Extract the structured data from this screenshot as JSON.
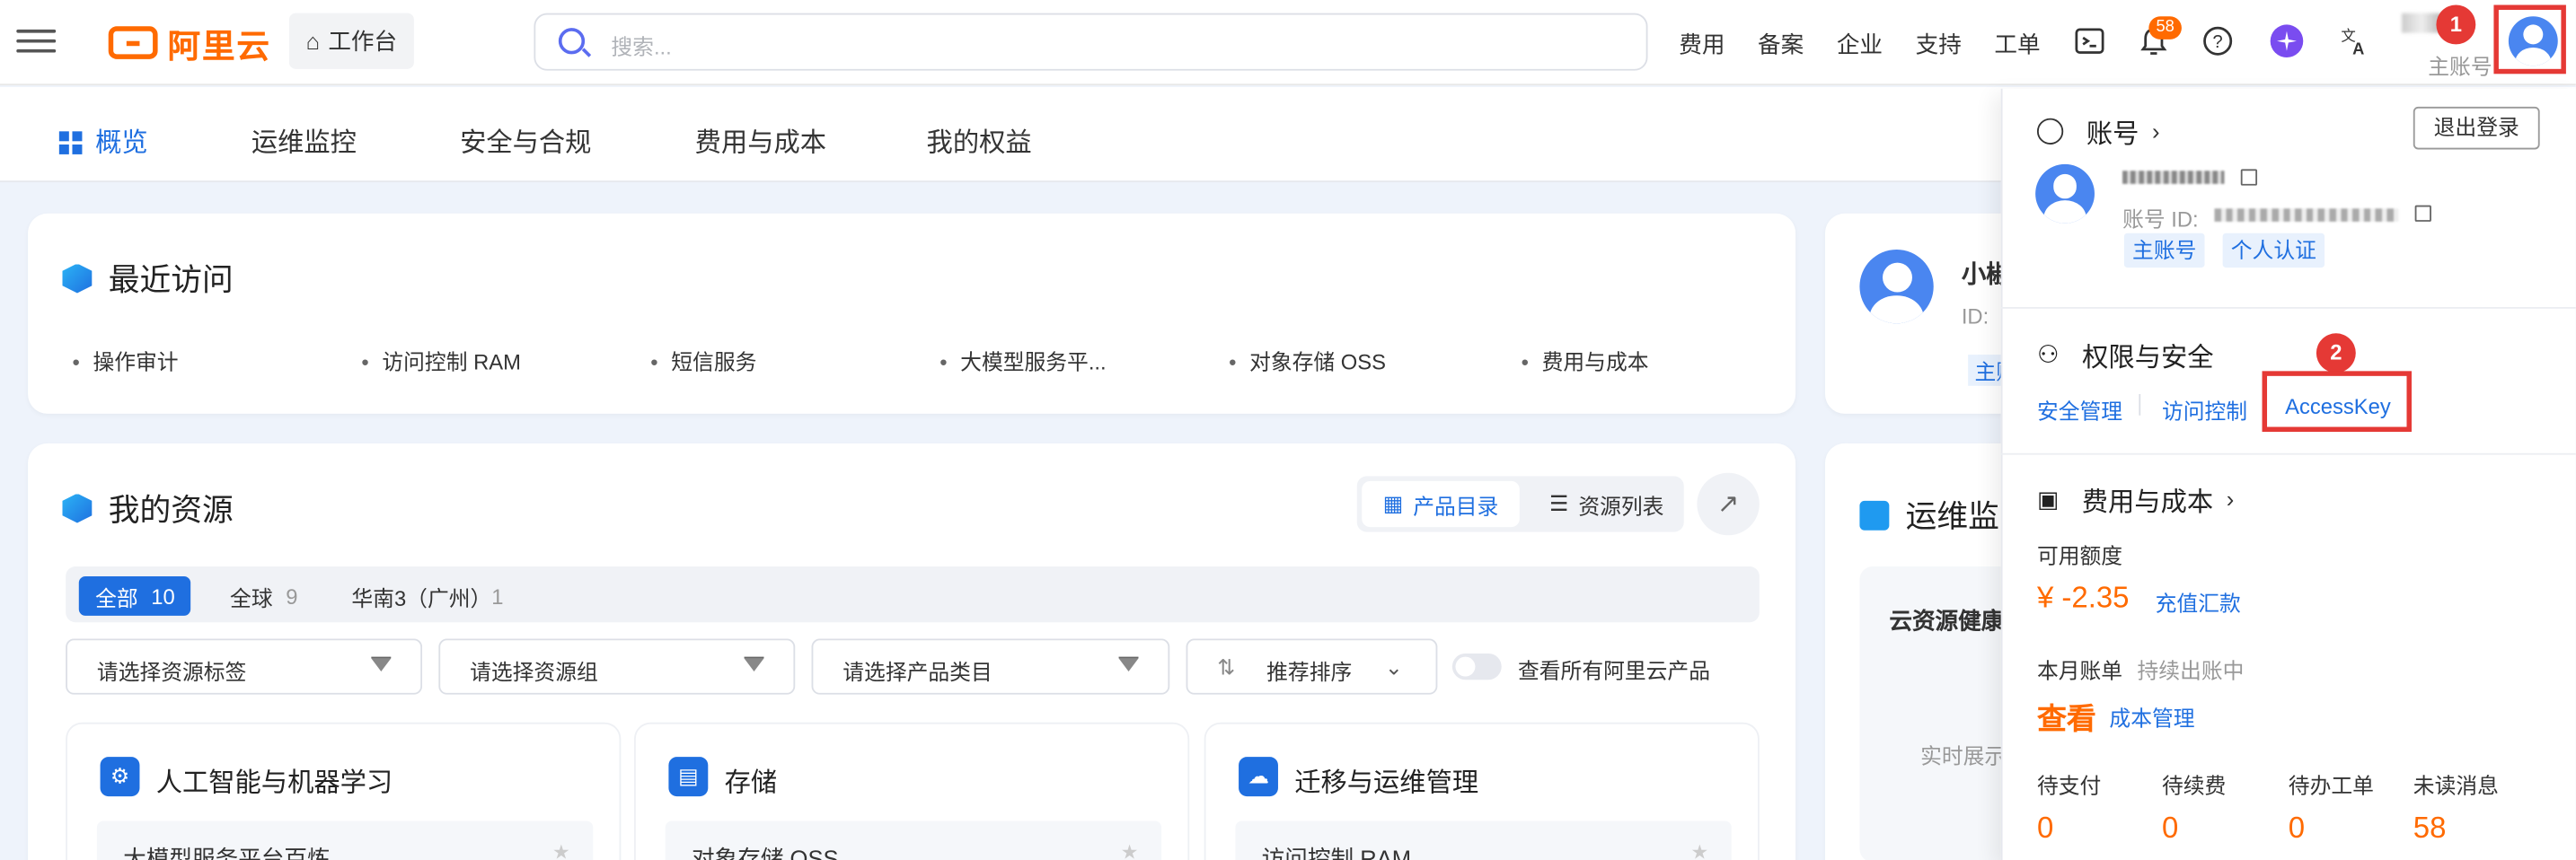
{
  "header": {
    "logo_text": "阿里云",
    "workbench_label": "工作台",
    "search_placeholder": "搜索...",
    "nav": [
      "费用",
      "备案",
      "企业",
      "支持",
      "工单"
    ],
    "notification_count": "58",
    "account_sub_label": "主账号"
  },
  "tabs": [
    "概览",
    "运维监控",
    "安全与合规",
    "费用与成本",
    "我的权益"
  ],
  "recent": {
    "title": "最近访问",
    "items": [
      "操作审计",
      "访问控制 RAM",
      "短信服务",
      "大模型服务平...",
      "对象存储 OSS",
      "费用与成本"
    ]
  },
  "resources": {
    "title": "我的资源",
    "view_product_catalog": "产品目录",
    "view_resource_list": "资源列表",
    "filter_tabs": [
      {
        "label": "全部",
        "count": "10"
      },
      {
        "label": "全球",
        "count": "9"
      },
      {
        "label": "华南3（广州）",
        "count": "1"
      }
    ],
    "select_tag_placeholder": "请选择资源标签",
    "select_group_placeholder": "请选择资源组",
    "select_category_placeholder": "请选择产品类目",
    "sort_label": "推荐排序",
    "show_all_label": "查看所有阿里云产品",
    "categories": [
      {
        "title": "人工智能与机器学习",
        "item": "大模型服务平台百炼"
      },
      {
        "title": "存储",
        "item": "对象存储 OSS"
      },
      {
        "title": "迁移与运维管理",
        "item": "访问控制 RAM"
      }
    ]
  },
  "side_cards": {
    "user_name_partial": "小椒",
    "id_label_partial": "ID:",
    "main_partial": "主账",
    "ops_title_partial": "运维监",
    "health_partial": "云资源健康",
    "realtime_partial": "实时展示"
  },
  "dropdown": {
    "account_title": "账号",
    "logout": "退出登录",
    "account_id_label": "账号 ID:",
    "tags": [
      "主账号",
      "个人认证"
    ],
    "security_title": "权限与安全",
    "security_links": [
      "安全管理",
      "访问控制",
      "AccessKey"
    ],
    "cost_title": "费用与成本",
    "available_label": "可用额度",
    "balance": "¥ -2.35",
    "recharge": "充值汇款",
    "monthly_bill": "本月账单",
    "billing_status": "持续出账中",
    "view": "查看",
    "cost_mgmt": "成本管理",
    "stats": [
      {
        "label": "待支付",
        "value": "0"
      },
      {
        "label": "待续费",
        "value": "0"
      },
      {
        "label": "待办工单",
        "value": "0"
      },
      {
        "label": "未读消息",
        "value": "58"
      }
    ]
  },
  "annotations": [
    "1",
    "2"
  ],
  "colors": {
    "accent": "#1f6fe0",
    "brand": "#ff6a00",
    "highlight": "#e53935"
  }
}
